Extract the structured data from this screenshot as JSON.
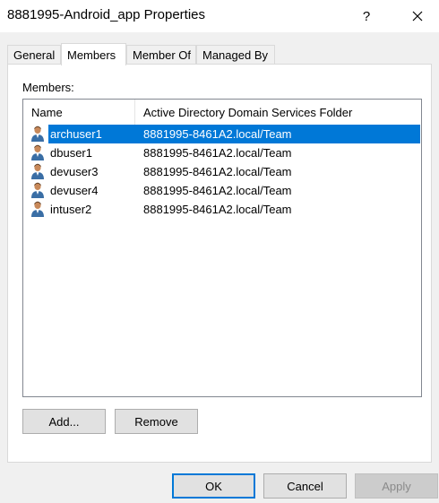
{
  "window": {
    "title": "8881995-Android_app Properties",
    "help_label": "?",
    "close_label": "✕"
  },
  "tabs": [
    {
      "label": "General"
    },
    {
      "label": "Members"
    },
    {
      "label": "Member Of"
    },
    {
      "label": "Managed By"
    }
  ],
  "members": {
    "label": "Members:",
    "columns": [
      "Name",
      "Active Directory Domain Services Folder"
    ],
    "rows": [
      {
        "name": "archuser1",
        "folder": "8881995-8461A2.local/Team",
        "selected": true
      },
      {
        "name": "dbuser1",
        "folder": "8881995-8461A2.local/Team",
        "selected": false
      },
      {
        "name": "devuser3",
        "folder": "8881995-8461A2.local/Team",
        "selected": false
      },
      {
        "name": "devuser4",
        "folder": "8881995-8461A2.local/Team",
        "selected": false
      },
      {
        "name": "intuser2",
        "folder": "8881995-8461A2.local/Team",
        "selected": false
      }
    ],
    "icon": "user-icon"
  },
  "buttons": {
    "add": "Add...",
    "remove": "Remove",
    "ok": "OK",
    "cancel": "Cancel",
    "apply": "Apply"
  },
  "colors": {
    "selection": "#0078d7",
    "dialog_bg": "#f0f0f0"
  }
}
